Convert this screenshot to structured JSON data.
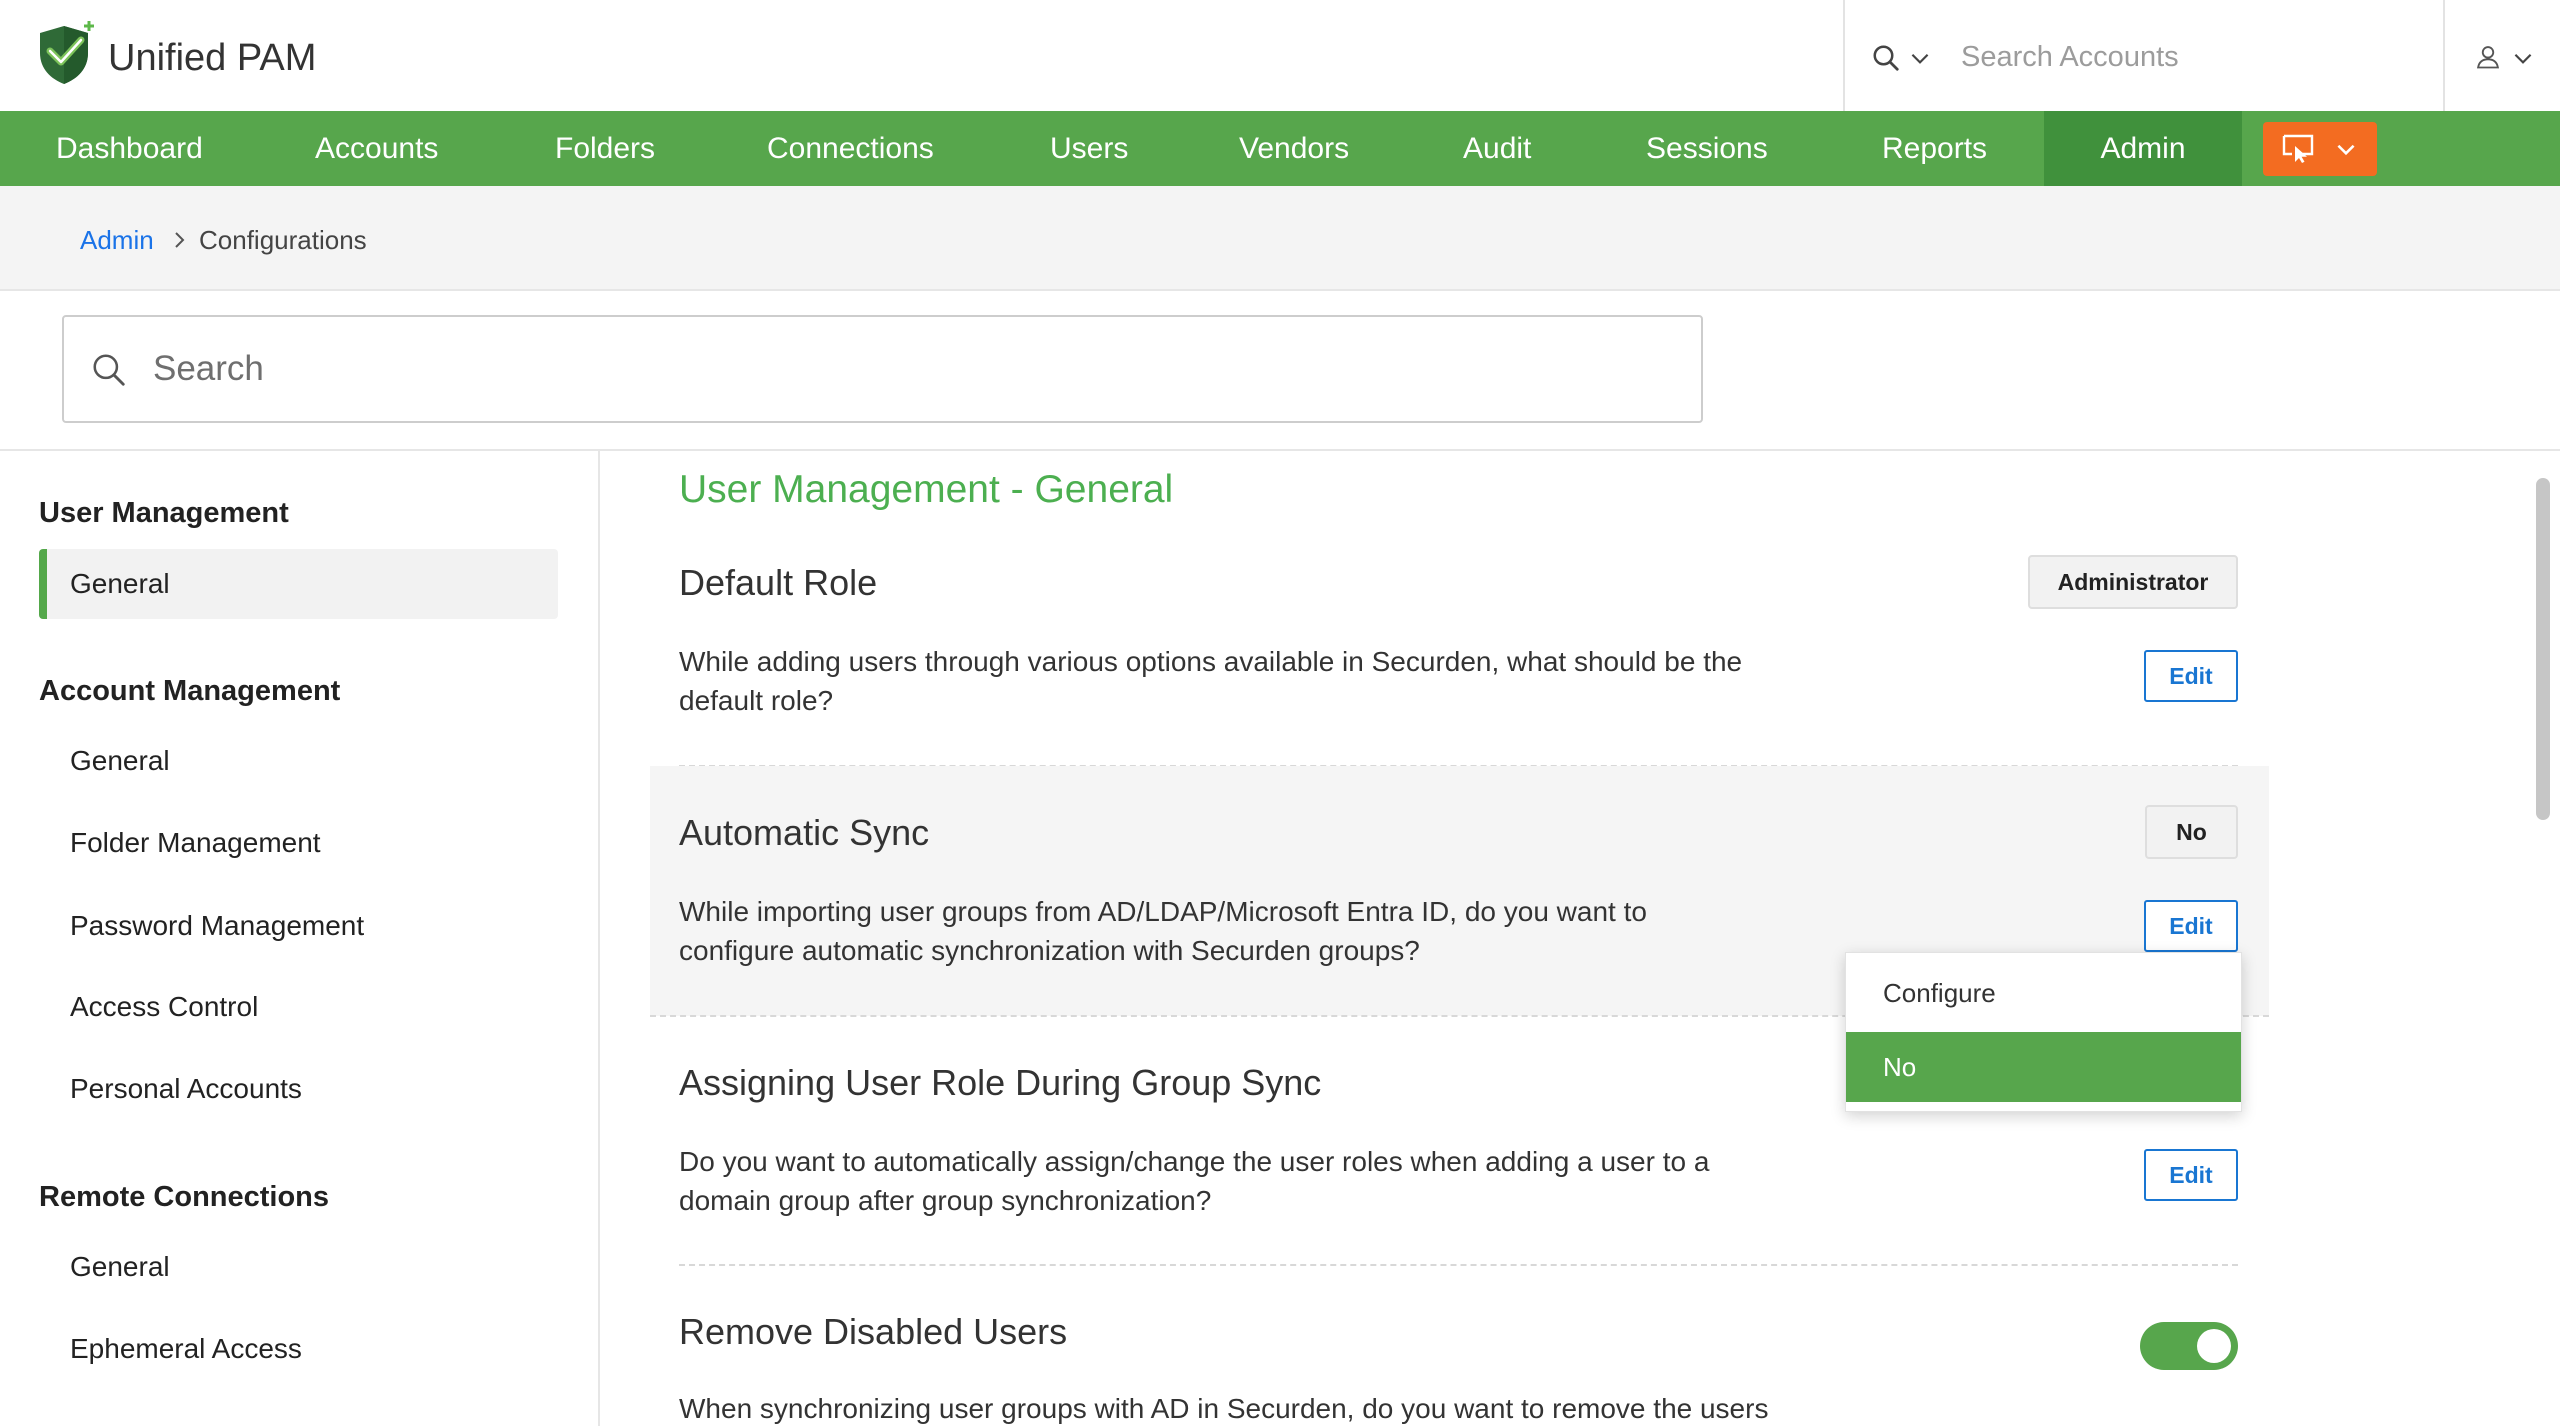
{
  "app": {
    "name": "Unified PAM",
    "logo_icon": "shield-check-logo-icon"
  },
  "header": {
    "search_placeholder": "Search Accounts",
    "search_icon": "search-icon",
    "search_scope_icon": "chevron-down-icon",
    "user_icon": "user-icon",
    "user_menu_icon": "chevron-down-icon"
  },
  "nav": {
    "items": [
      {
        "label": "Dashboard",
        "active": false
      },
      {
        "label": "Accounts",
        "active": false
      },
      {
        "label": "Folders",
        "active": false
      },
      {
        "label": "Connections",
        "active": false
      },
      {
        "label": "Users",
        "active": false
      },
      {
        "label": "Vendors",
        "active": false
      },
      {
        "label": "Audit",
        "active": false
      },
      {
        "label": "Sessions",
        "active": false
      },
      {
        "label": "Reports",
        "active": false
      },
      {
        "label": "Admin",
        "active": true
      }
    ],
    "launch_button": {
      "icon": "remote-session-icon",
      "menu_icon": "chevron-down-icon"
    }
  },
  "breadcrumb": {
    "items": [
      {
        "label": "Admin",
        "is_link": true
      },
      {
        "label": "Configurations",
        "is_link": false
      }
    ],
    "separator_icon": "chevron-right-icon"
  },
  "settings_search": {
    "placeholder": "Search",
    "icon": "search-icon"
  },
  "sidebar": {
    "sections": [
      {
        "heading": "User Management",
        "items": [
          {
            "label": "General",
            "active": true
          }
        ]
      },
      {
        "heading": "Account Management",
        "items": [
          {
            "label": "General",
            "active": false
          },
          {
            "label": "Folder Management",
            "active": false
          },
          {
            "label": "Password Management",
            "active": false
          },
          {
            "label": "Access Control",
            "active": false
          },
          {
            "label": "Personal Accounts",
            "active": false
          }
        ]
      },
      {
        "heading": "Remote Connections",
        "items": [
          {
            "label": "General",
            "active": false
          },
          {
            "label": "Ephemeral Access",
            "active": false
          }
        ]
      }
    ]
  },
  "main": {
    "title": "User Management - General",
    "settings": [
      {
        "heading": "Default Role",
        "value": "Administrator",
        "description_lines": [
          "While adding users through various options available in Securden, what should be the",
          "default role?"
        ],
        "action": "Edit"
      },
      {
        "heading": "Automatic Sync",
        "value": "No",
        "description_lines": [
          "While importing user groups from AD/LDAP/Microsoft Entra ID, do you want to",
          "configure automatic synchronization with Securden groups?"
        ],
        "action": "Edit",
        "dropdown_open": true
      },
      {
        "heading": "Assigning User Role During Group Sync",
        "description_lines": [
          "Do you want to automatically assign/change the user roles when adding a user to a",
          "domain group after group synchronization?"
        ],
        "action": "Edit"
      },
      {
        "heading": "Remove Disabled Users",
        "toggle_on": true,
        "description_lines": [
          "When synchronizing user groups with AD in Securden, do you want to remove the users"
        ]
      }
    ],
    "dropdown": {
      "options": [
        {
          "label": "Configure",
          "selected": false
        },
        {
          "label": "No",
          "selected": true
        }
      ]
    }
  },
  "colors": {
    "nav_green": "#57a64c",
    "nav_active": "#40913c",
    "launch_orange": "#f36c21",
    "link_blue": "#1a73e8",
    "title_green": "#4caf50",
    "edit_blue": "#1976d2",
    "toggle_on": "#57a64c"
  }
}
